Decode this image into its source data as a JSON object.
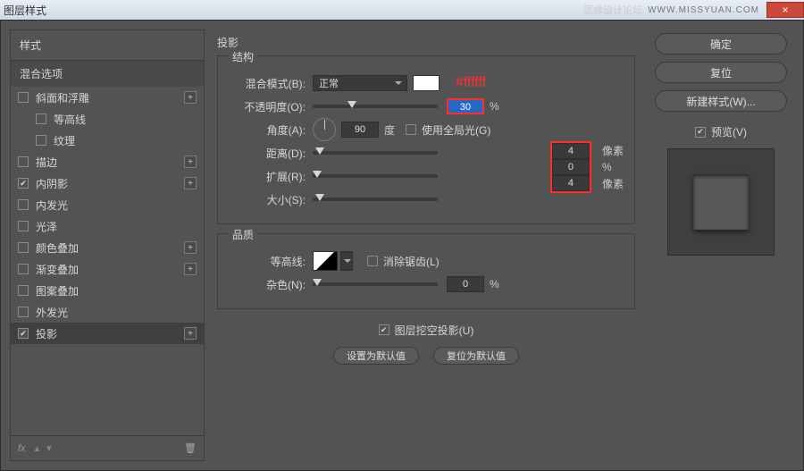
{
  "titlebar": {
    "title": "图层样式",
    "ribbon": "思缘设计论坛",
    "watermark": "WWW.MISSYUAN.COM",
    "close": "×"
  },
  "left": {
    "header": "样式",
    "subheader": "混合选项",
    "items": [
      {
        "label": "斜面和浮雕",
        "checked": false,
        "plus": true
      },
      {
        "label": "等高线",
        "checked": false,
        "child": true
      },
      {
        "label": "纹理",
        "checked": false,
        "child": true
      },
      {
        "label": "描边",
        "checked": false,
        "plus": true
      },
      {
        "label": "内阴影",
        "checked": true,
        "plus": true
      },
      {
        "label": "内发光",
        "checked": false
      },
      {
        "label": "光泽",
        "checked": false
      },
      {
        "label": "颜色叠加",
        "checked": false,
        "plus": true
      },
      {
        "label": "渐变叠加",
        "checked": false,
        "plus": true
      },
      {
        "label": "图案叠加",
        "checked": false
      },
      {
        "label": "外发光",
        "checked": false
      },
      {
        "label": "投影",
        "checked": true,
        "plus": true,
        "selected": true
      }
    ],
    "foot_fx": "fx"
  },
  "mid": {
    "title": "投影",
    "structure": {
      "legend": "结构",
      "blend_label": "混合模式(B):",
      "blend_value": "正常",
      "hex_annot": "#ffffff",
      "opacity_label": "不透明度(O):",
      "opacity_value": "30",
      "opacity_unit": "%",
      "angle_label": "角度(A):",
      "angle_value": "90",
      "angle_unit": "度",
      "global_label": "使用全局光(G)",
      "global_checked": false,
      "distance_label": "距离(D):",
      "distance_value": "4",
      "distance_unit": "像素",
      "spread_label": "扩展(R):",
      "spread_value": "0",
      "spread_unit": "%",
      "size_label": "大小(S):",
      "size_value": "4",
      "size_unit": "像素"
    },
    "quality": {
      "legend": "品质",
      "contour_label": "等高线:",
      "aa_label": "消除锯齿(L)",
      "aa_checked": false,
      "noise_label": "杂色(N):",
      "noise_value": "0",
      "noise_unit": "%"
    },
    "knockout": {
      "label": "图层挖空投影(U)",
      "checked": true
    },
    "btn_default": "设置为默认值",
    "btn_reset": "复位为默认值"
  },
  "right": {
    "ok": "确定",
    "reset": "复位",
    "new_style": "新建样式(W)...",
    "preview_label": "预览(V)",
    "preview_checked": true
  }
}
